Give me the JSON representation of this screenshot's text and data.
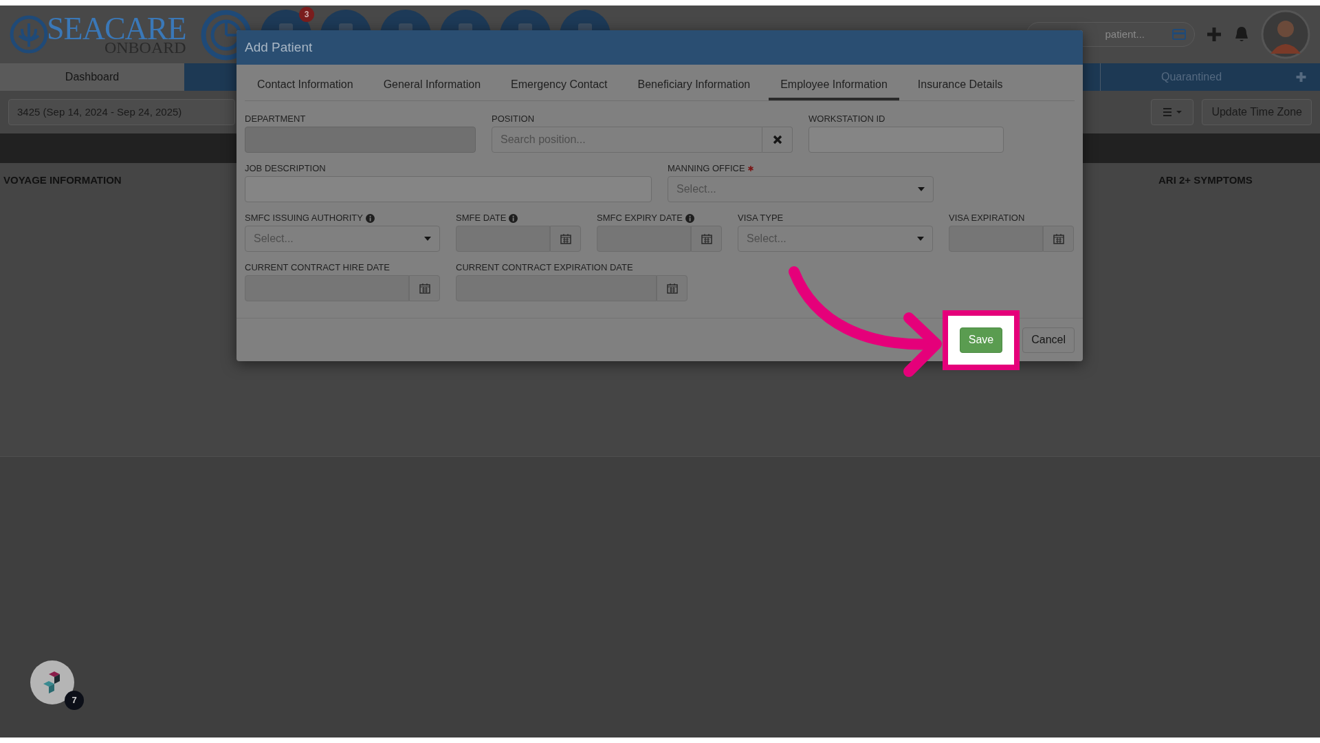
{
  "header": {
    "logo": {
      "name": "SEACARE",
      "tagline": "ONBOARD"
    },
    "nav_icons": [
      {
        "kind": "chart"
      },
      {
        "kind": "plain",
        "badge": "3"
      },
      {
        "kind": "plain"
      },
      {
        "kind": "plain"
      },
      {
        "kind": "plain"
      },
      {
        "kind": "plain"
      },
      {
        "kind": "plain"
      }
    ],
    "search": {
      "placeholder": "patient..."
    }
  },
  "nav_tabs": [
    {
      "label": "Dashboard",
      "selected": true
    },
    {
      "label": "Quarantined",
      "selected": false
    }
  ],
  "voyage_select": {
    "value": "3425 (Sep 14, 2024 - Sep 24, 2025)"
  },
  "toolbar": {
    "update_button": "Update Time Zone"
  },
  "sections": [
    {
      "title": "VOYAGE INFORMATION"
    },
    {
      "title": "ARI 2+ SYMPTOMS"
    }
  ],
  "chat_widget": {
    "badge": "7"
  },
  "modal": {
    "title": "Add Patient",
    "tabs": [
      {
        "label": "Contact Information",
        "selected": false
      },
      {
        "label": "General Information",
        "selected": false
      },
      {
        "label": "Emergency Contact",
        "selected": false
      },
      {
        "label": "Beneficiary Information",
        "selected": false
      },
      {
        "label": "Employee Information",
        "selected": true
      },
      {
        "label": "Insurance Details",
        "selected": false
      }
    ],
    "rows": [
      [
        {
          "label": "DEPARTMENT",
          "kind": "text",
          "disabled": true
        },
        {
          "label": "POSITION",
          "kind": "search",
          "placeholder": "Search position..."
        },
        {
          "label": "WORKSTATION ID",
          "kind": "text",
          "disabled": false
        }
      ],
      [
        {
          "label": "JOB DESCRIPTION",
          "kind": "text",
          "disabled": false
        },
        {
          "label": "MANNING OFFICE",
          "kind": "select",
          "placeholder": "Select...",
          "required": true
        }
      ],
      [
        {
          "label": "SMFC ISSUING AUTHORITY",
          "kind": "select",
          "placeholder": "Select...",
          "info": true
        },
        {
          "label": "SMFE DATE",
          "kind": "date",
          "info": true
        },
        {
          "label": "SMFC EXPIRY DATE",
          "kind": "date",
          "info": true
        },
        {
          "label": "VISA TYPE",
          "kind": "select",
          "placeholder": "Select..."
        },
        {
          "label": "VISA EXPIRATION",
          "kind": "date"
        }
      ],
      [
        {
          "label": "CURRENT CONTRACT HIRE DATE",
          "kind": "date"
        },
        {
          "label": "CURRENT CONTRACT EXPIRATION DATE",
          "kind": "date"
        }
      ]
    ],
    "buttons": [
      {
        "kind": "primary",
        "label": "Save",
        "highlighted": true
      },
      {
        "kind": "default",
        "label": "Cancel",
        "highlighted": false
      }
    ]
  }
}
